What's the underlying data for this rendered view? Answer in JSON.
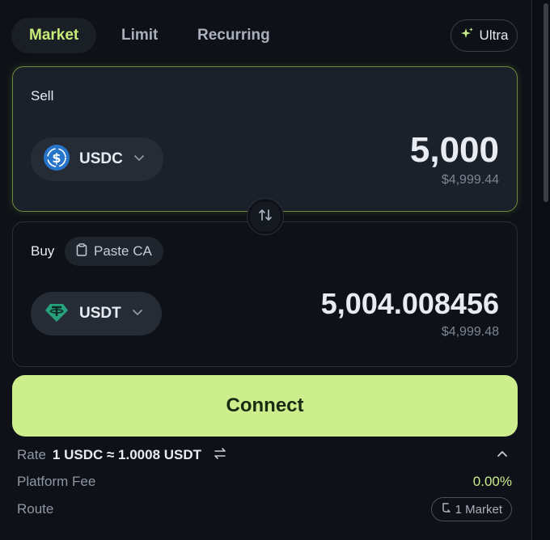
{
  "tabs": [
    {
      "label": "Market",
      "active": true
    },
    {
      "label": "Limit",
      "active": false
    },
    {
      "label": "Recurring",
      "active": false
    }
  ],
  "ultra": {
    "label": "Ultra",
    "icon": "sparkle-icon"
  },
  "sell": {
    "label": "Sell",
    "token": {
      "symbol": "USDC",
      "icon": "usdc-coin-icon",
      "color": "#2775ca"
    },
    "amount": "5,000",
    "usd_value": "$4,999.44"
  },
  "swap_direction": {
    "icon": "swap-vertical-icon"
  },
  "buy": {
    "label": "Buy",
    "paste_ca": {
      "label": "Paste CA",
      "icon": "clipboard-icon"
    },
    "token": {
      "symbol": "USDT",
      "icon": "usdt-coin-icon",
      "color": "#26a17b"
    },
    "amount": "5,004.008456",
    "usd_value": "$4,999.48"
  },
  "connect": {
    "label": "Connect"
  },
  "details": {
    "rate": {
      "label": "Rate",
      "value": "1 USDC ≈ 1.0008 USDT",
      "icon": "swap-horizontal-icon"
    },
    "collapse_icon": "chevron-up-icon",
    "platform_fee": {
      "label": "Platform Fee",
      "value": "0.00%"
    },
    "route": {
      "label": "Route",
      "value": "1 Market",
      "icon": "route-icon"
    }
  },
  "colors": {
    "accent": "#cdee8d",
    "active_tab_text": "#c7ec7a",
    "background": "#0e1117"
  }
}
